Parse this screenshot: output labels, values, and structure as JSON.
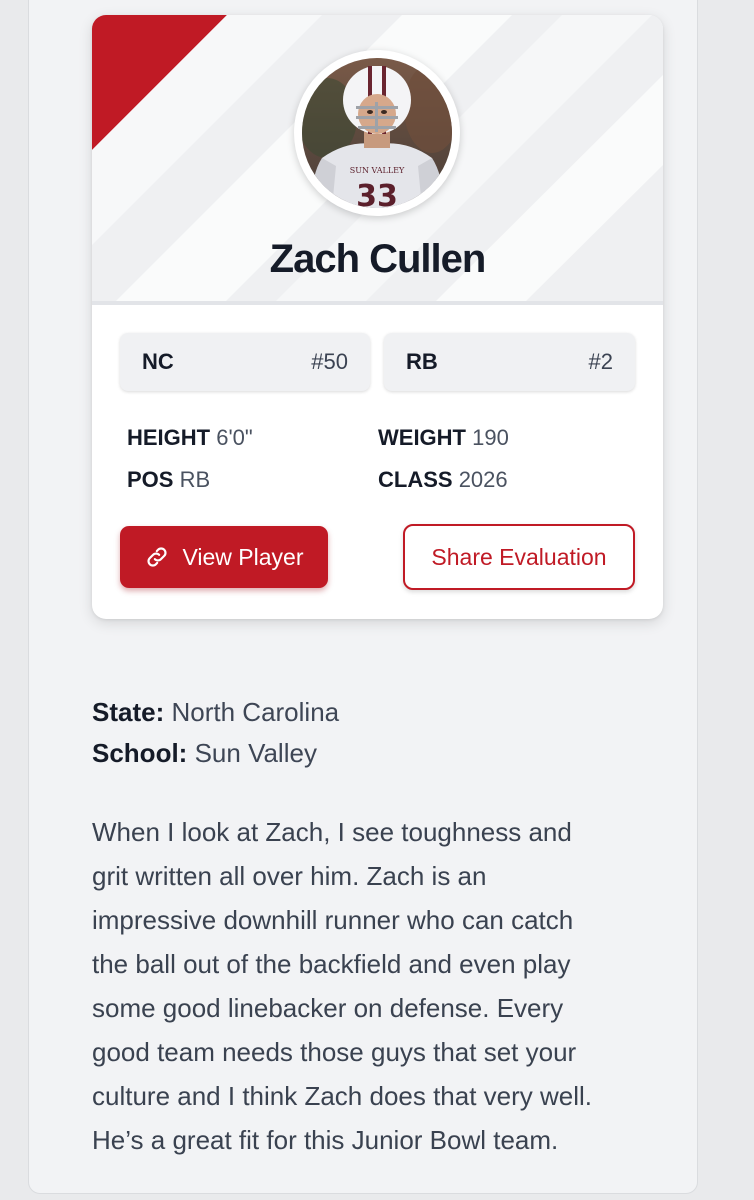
{
  "player": {
    "name": "Zach Cullen"
  },
  "badges": {
    "state": {
      "label": "NC",
      "rank": "#50"
    },
    "position": {
      "label": "RB",
      "rank": "#2"
    }
  },
  "stats": {
    "height": {
      "label": "HEIGHT",
      "value": "6'0\""
    },
    "weight": {
      "label": "WEIGHT",
      "value": "190"
    },
    "pos": {
      "label": "POS",
      "value": "RB"
    },
    "class": {
      "label": "CLASS",
      "value": "2026"
    }
  },
  "actions": {
    "view_label": "View Player",
    "share_label": "Share Evaluation"
  },
  "details": {
    "state": {
      "label": "State:",
      "value": "North Carolina"
    },
    "school": {
      "label": "School:",
      "value": "Sun Valley"
    }
  },
  "bio_lines": [
    "When I look at Zach, I see toughness and",
    "grit written all over him. Zach is an",
    "impressive downhill runner who can catch",
    "the ball out of the backfield and even play",
    "some good linebacker on defense. Every",
    "good team needs those guys that set your",
    "culture and I think Zach does that very well.",
    "He’s a great fit for this Junior Bowl team."
  ],
  "colors": {
    "accent": "#c01a25",
    "text_dark": "#151b28",
    "card_bg": "#ffffff",
    "page_bg": "#e9eaec"
  },
  "icons": {
    "view_button": "link-icon"
  }
}
